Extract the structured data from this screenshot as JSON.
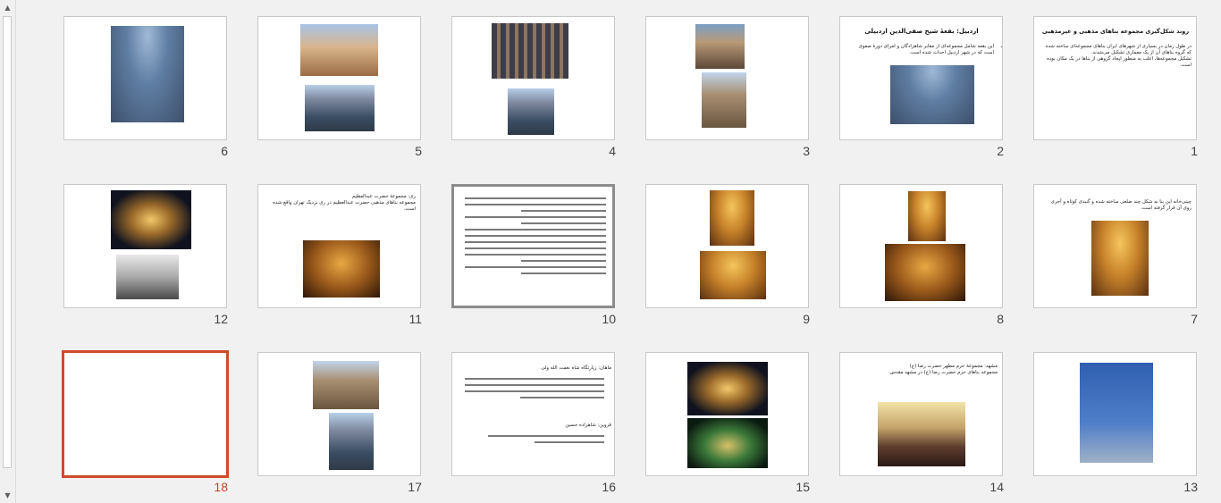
{
  "slides": [
    {
      "number": "1",
      "title": "روند شکل‌گیری مجموعه بناهای مذهبی و غیرمذهبی",
      "body": [
        "در طول زمان در بسیاری از شهرهای ایران بناهای مجموعه‌ای ساخته شده که گروه بناهای آن از یک معماری تشکیل می‌شدند.",
        "تشکیل مجموعه‌ها، اغلب به منظور ایجاد گروهی از بناها در یک مکان بوده است."
      ]
    },
    {
      "number": "2",
      "title": "اردبیل: بقعۀ شیخ صفی‌الدین اردبیلی",
      "body": [
        "این بقعه شامل مجموعه‌ای از مقابر شاهزادگان و امرای دورۀ صفوی است که در شهر اردبیل احداث شده است."
      ]
    },
    {
      "number": "3"
    },
    {
      "number": "4"
    },
    {
      "number": "5"
    },
    {
      "number": "6"
    },
    {
      "number": "7",
      "body": [
        "چینی‌خانه این بنا به شکل چند ضلعی ساخته شده و گنبدی کوتاه و آجری روی آن قرار گرفته است."
      ]
    },
    {
      "number": "8"
    },
    {
      "number": "9"
    },
    {
      "number": "10"
    },
    {
      "number": "11",
      "body": [
        "ری: مجموعۀ حضرت عبدالعظیم",
        "مجموعه بناهای مذهبی حضرت عبدالعظیم در ری نزدیک تهران واقع شده است."
      ]
    },
    {
      "number": "12"
    },
    {
      "number": "13"
    },
    {
      "number": "14",
      "body": [
        "مشهد: مجموعۀ حرم مطهر حضرت رضا (ع)",
        "مجموعه بناهای حرم حضرت رضا (ع) در مشهد مقدس."
      ]
    },
    {
      "number": "15"
    },
    {
      "number": "16",
      "body": [
        "ماهان: زیارتگاه شاه نعمت الله ولی",
        "قزوین: شاهزاده حسین"
      ]
    },
    {
      "number": "17"
    },
    {
      "number": "18"
    }
  ]
}
